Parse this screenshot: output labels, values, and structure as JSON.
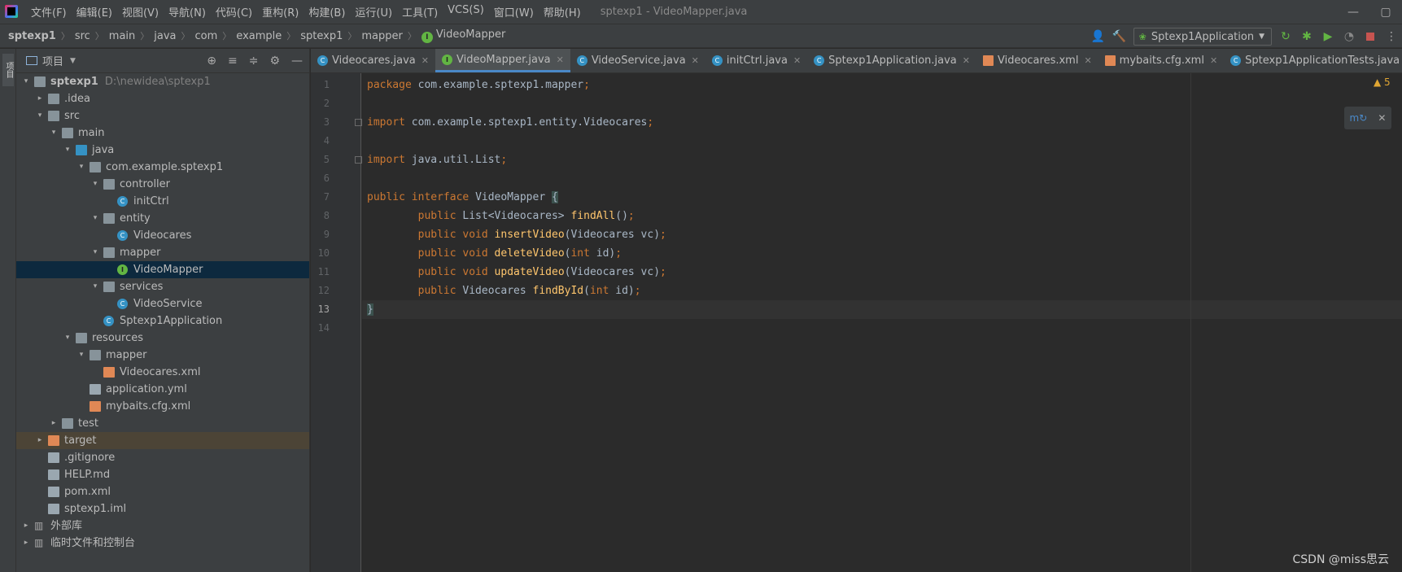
{
  "window": {
    "title": "sptexp1 - VideoMapper.java",
    "menu": [
      "文件(F)",
      "编辑(E)",
      "视图(V)",
      "导航(N)",
      "代码(C)",
      "重构(R)",
      "构建(B)",
      "运行(U)",
      "工具(T)",
      "VCS(S)",
      "窗口(W)",
      "帮助(H)"
    ]
  },
  "breadcrumb": [
    "sptexp1",
    "src",
    "main",
    "java",
    "com",
    "example",
    "sptexp1",
    "mapper",
    "VideoMapper"
  ],
  "toolbar": {
    "run_config": "Sptexp1Application",
    "icons": [
      "user-icon",
      "hammer-icon",
      "rerun-icon",
      "debug-icon",
      "coverage-icon",
      "profile-icon",
      "stop-icon"
    ]
  },
  "project_panel": {
    "title": "项目",
    "tree": [
      {
        "label": "sptexp1",
        "path": "D:\\newidea\\sptexp1",
        "icon": "folder",
        "arrow": "▾"
      },
      {
        "label": ".idea",
        "icon": "folder",
        "arrow": "▸"
      },
      {
        "label": "src",
        "icon": "folder",
        "arrow": "▾"
      },
      {
        "label": "main",
        "icon": "folder",
        "arrow": "▾"
      },
      {
        "label": "java",
        "icon": "folder-blue",
        "arrow": "▾"
      },
      {
        "label": "com.example.sptexp1",
        "icon": "folder",
        "arrow": "▾"
      },
      {
        "label": "controller",
        "icon": "folder",
        "arrow": "▾"
      },
      {
        "label": "initCtrl",
        "icon": "class",
        "arrow": ""
      },
      {
        "label": "entity",
        "icon": "folder",
        "arrow": "▾"
      },
      {
        "label": "Videocares",
        "icon": "class",
        "arrow": ""
      },
      {
        "label": "mapper",
        "icon": "folder",
        "arrow": "▾"
      },
      {
        "label": "VideoMapper",
        "icon": "interface",
        "arrow": "",
        "selected": true
      },
      {
        "label": "services",
        "icon": "folder",
        "arrow": "▾"
      },
      {
        "label": "VideoService",
        "icon": "class",
        "arrow": ""
      },
      {
        "label": "Sptexp1Application",
        "icon": "class",
        "arrow": ""
      },
      {
        "label": "resources",
        "icon": "folder",
        "arrow": "▾"
      },
      {
        "label": "mapper",
        "icon": "folder",
        "arrow": "▾"
      },
      {
        "label": "Videocares.xml",
        "icon": "xml",
        "arrow": ""
      },
      {
        "label": "application.yml",
        "icon": "file",
        "arrow": ""
      },
      {
        "label": "mybaits.cfg.xml",
        "icon": "xml",
        "arrow": ""
      },
      {
        "label": "test",
        "icon": "folder",
        "arrow": "▸"
      },
      {
        "label": "target",
        "icon": "folder-orange",
        "arrow": "▸",
        "excluded": true
      },
      {
        "label": ".gitignore",
        "icon": "file",
        "arrow": ""
      },
      {
        "label": "HELP.md",
        "icon": "file",
        "arrow": ""
      },
      {
        "label": "pom.xml",
        "icon": "file",
        "arrow": ""
      },
      {
        "label": "sptexp1.iml",
        "icon": "file",
        "arrow": ""
      },
      {
        "label": "外部库",
        "icon": "lib",
        "arrow": "▸"
      },
      {
        "label": "临时文件和控制台",
        "icon": "lib",
        "arrow": "▸"
      }
    ]
  },
  "tabs": [
    {
      "label": "Videocares.java",
      "icon": "class"
    },
    {
      "label": "VideoMapper.java",
      "icon": "interface",
      "active": true
    },
    {
      "label": "VideoService.java",
      "icon": "class"
    },
    {
      "label": "initCtrl.java",
      "icon": "class"
    },
    {
      "label": "Sptexp1Application.java",
      "icon": "class"
    },
    {
      "label": "Videocares.xml",
      "icon": "xml"
    },
    {
      "label": "mybaits.cfg.xml",
      "icon": "xml"
    },
    {
      "label": "Sptexp1ApplicationTests.java",
      "icon": "class"
    }
  ],
  "editor": {
    "current_line": 13,
    "warning_count": "5",
    "lines": [
      [
        {
          "t": "package ",
          "c": "kw"
        },
        {
          "t": "com.example.sptexp1.mapper",
          "c": ""
        },
        {
          "t": ";",
          "c": "kw"
        }
      ],
      [],
      [
        {
          "t": "import ",
          "c": "kw"
        },
        {
          "t": "com.example.sptexp1.entity.Videocares",
          "c": ""
        },
        {
          "t": ";",
          "c": "kw"
        }
      ],
      [],
      [
        {
          "t": "import ",
          "c": "kw"
        },
        {
          "t": "java.util.List",
          "c": ""
        },
        {
          "t": ";",
          "c": "kw"
        }
      ],
      [],
      [
        {
          "t": "public interface ",
          "c": "kw"
        },
        {
          "t": "VideoMapper ",
          "c": ""
        },
        {
          "t": "{",
          "c": "brace"
        }
      ],
      [
        {
          "t": "        public ",
          "c": "kw"
        },
        {
          "t": "List<Videocares> ",
          "c": ""
        },
        {
          "t": "findAll",
          "c": "fn"
        },
        {
          "t": "()",
          "c": ""
        },
        {
          "t": ";",
          "c": "kw"
        }
      ],
      [
        {
          "t": "        public void ",
          "c": "kw"
        },
        {
          "t": "insertVideo",
          "c": "fn"
        },
        {
          "t": "(Videocares vc)",
          "c": ""
        },
        {
          "t": ";",
          "c": "kw"
        }
      ],
      [
        {
          "t": "        public void ",
          "c": "kw"
        },
        {
          "t": "deleteVideo",
          "c": "fn"
        },
        {
          "t": "(",
          "c": ""
        },
        {
          "t": "int ",
          "c": "kw"
        },
        {
          "t": "id)",
          "c": ""
        },
        {
          "t": ";",
          "c": "kw"
        }
      ],
      [
        {
          "t": "        public void ",
          "c": "kw"
        },
        {
          "t": "updateVideo",
          "c": "fn"
        },
        {
          "t": "(Videocares vc)",
          "c": ""
        },
        {
          "t": ";",
          "c": "kw"
        }
      ],
      [
        {
          "t": "        public ",
          "c": "kw"
        },
        {
          "t": "Videocares ",
          "c": ""
        },
        {
          "t": "findById",
          "c": "fn"
        },
        {
          "t": "(",
          "c": ""
        },
        {
          "t": "int ",
          "c": "kw"
        },
        {
          "t": "id)",
          "c": ""
        },
        {
          "t": ";",
          "c": "kw"
        }
      ],
      [
        {
          "t": "}",
          "c": "brace"
        }
      ],
      []
    ]
  },
  "watermark": "CSDN @miss思云",
  "colors": {
    "keyword": "#cc7832",
    "function": "#ffc66d",
    "text": "#a9b7c6",
    "selection": "#0d293e",
    "accent": "#4a88c7"
  }
}
